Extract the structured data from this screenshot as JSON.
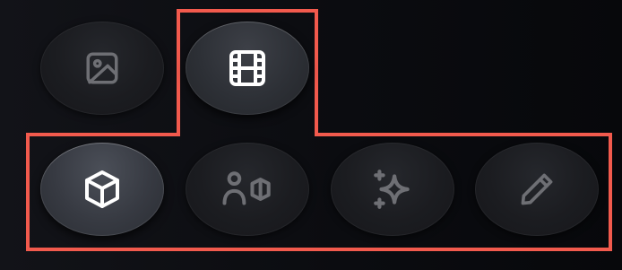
{
  "toolbar": {
    "buttons": [
      {
        "id": "image",
        "icon": "image-icon",
        "state": "inactive"
      },
      {
        "id": "video",
        "icon": "film-icon",
        "state": "active"
      },
      {
        "id": "3d-object",
        "icon": "cube-icon",
        "state": "active"
      },
      {
        "id": "character",
        "icon": "person-shape-icon",
        "state": "inactive"
      },
      {
        "id": "magic",
        "icon": "sparkles-icon",
        "state": "inactive"
      },
      {
        "id": "edit",
        "icon": "pencil-icon",
        "state": "inactive"
      }
    ],
    "highlight_color": "#f25a4d",
    "active_icon_color": "#ffffff",
    "inactive_icon_color": "#6e6f74"
  }
}
